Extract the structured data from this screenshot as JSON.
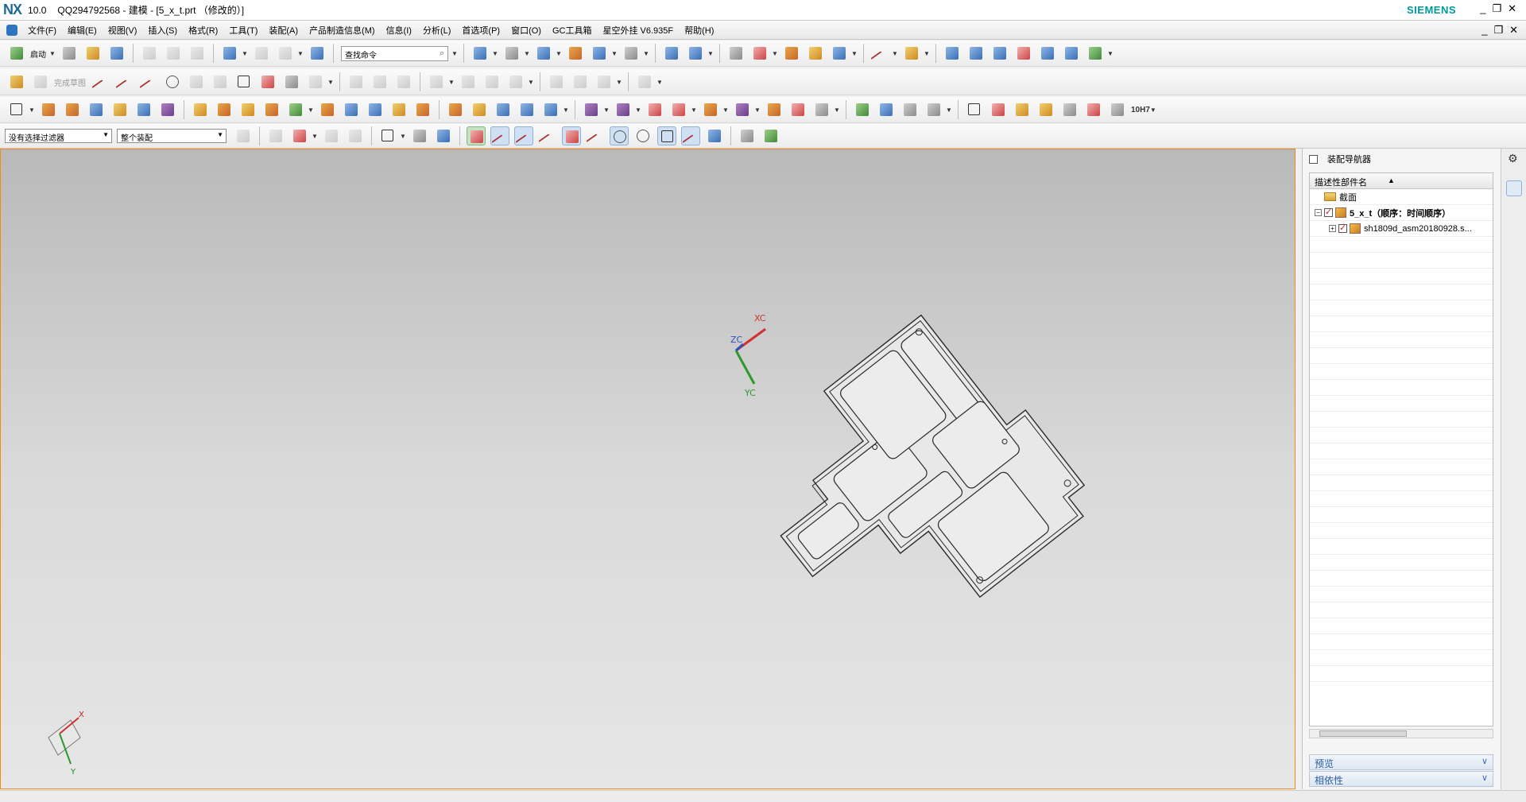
{
  "titlebar": {
    "logo": "NX",
    "version": "10.0",
    "title": "QQ294792568 - 建模 - [5_x_t.prt （修改的）]",
    "brand": "SIEMENS",
    "controls": [
      "_",
      "❐",
      "✕"
    ]
  },
  "menubar": {
    "items": [
      "文件(F)",
      "编辑(E)",
      "视图(V)",
      "插入(S)",
      "格式(R)",
      "工具(T)",
      "装配(A)",
      "产品制造信息(M)",
      "信息(I)",
      "分析(L)",
      "首选项(P)",
      "窗口(O)",
      "GC工具箱",
      "星空外挂 V6.935F",
      "帮助(H)"
    ],
    "controls": [
      "_",
      "❐",
      "✕"
    ]
  },
  "toolbar1": {
    "start_label": "启动",
    "search_placeholder": "查找命令"
  },
  "toolbar2": {
    "finish_sketch_label": "完成草图"
  },
  "toolbar3": {
    "fit_label": "10H7"
  },
  "selectionbar": {
    "filter_value": "没有选择过滤器",
    "scope_value": "整个装配"
  },
  "graphics": {
    "view_triad": {
      "x_label": "XC",
      "y_label": "YC",
      "z_label": "ZC"
    },
    "abs_triad": {
      "x_label": "X",
      "y_label": "Y"
    }
  },
  "navigator": {
    "title": "装配导航器",
    "column_header": "描述性部件名",
    "rows": [
      {
        "label": "截面",
        "level": 0
      },
      {
        "label": "5_x_t（顺序：时间顺序）",
        "level": 0
      },
      {
        "label": "sh1809d_asm20180928.s...",
        "level": 1
      }
    ],
    "preview_label": "预览",
    "dependency_label": "相依性"
  },
  "colors": {
    "graphics_border": "#f08a1a",
    "brand": "#009999",
    "checkmark": "#d02020"
  }
}
